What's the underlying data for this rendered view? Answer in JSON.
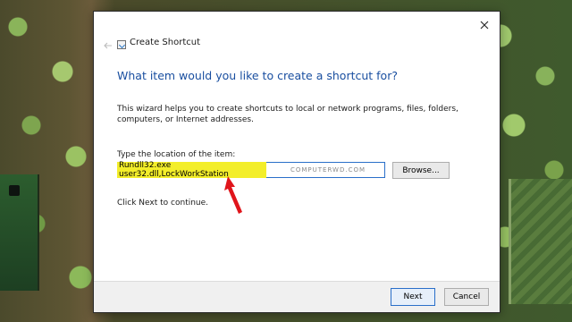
{
  "window": {
    "title": "Create Shortcut"
  },
  "content": {
    "heading": "What item would you like to create a shortcut for?",
    "description": "This wizard helps you to create shortcuts to local or network programs, files, folders, computers, or Internet addresses.",
    "location_label": "Type the location of the item:",
    "location_value": "Rundll32.exe user32.dll,LockWorkStation",
    "watermark": "COMPUTERWD.COM",
    "browse_label": "Browse...",
    "next_hint": "Click Next to continue."
  },
  "footer": {
    "next_label": "Next",
    "cancel_label": "Cancel"
  },
  "colors": {
    "heading": "#1a4fa0",
    "highlight": "#f3ee2a",
    "arrow": "#e0151b",
    "focus_border": "#2a6fc9"
  },
  "icons": {
    "close": "close-icon",
    "back": "back-arrow-icon",
    "wizard": "shortcut-wizard-icon",
    "annotation": "red-arrow-icon"
  }
}
